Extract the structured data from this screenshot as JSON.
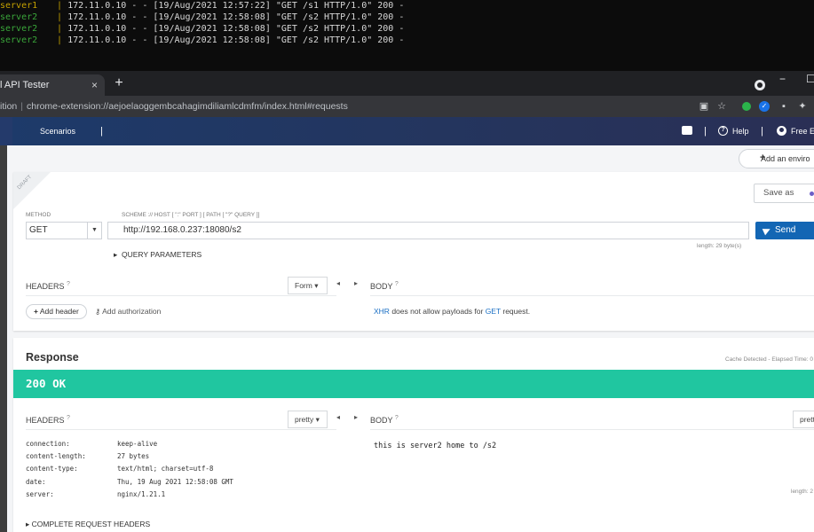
{
  "terminal": {
    "lines": [
      {
        "name": "server1",
        "text": "172.11.0.10 - - [19/Aug/2021 12:57:22] \"GET /s1 HTTP/1.0\" 200 -"
      },
      {
        "name": "server2",
        "text": "172.11.0.10 - - [19/Aug/2021 12:58:08] \"GET /s2 HTTP/1.0\" 200 -"
      },
      {
        "name": "server2",
        "text": "172.11.0.10 - - [19/Aug/2021 12:58:08] \"GET /s2 HTTP/1.0\" 200 -"
      },
      {
        "name": "server2",
        "text": "172.11.0.10 - - [19/Aug/2021 12:58:08] \"GET /s2 HTTP/1.0\" 200 -"
      }
    ],
    "separator": "|"
  },
  "browser": {
    "tab_title": "l API Tester",
    "tab_close": "×",
    "new_tab": "+",
    "min": "−",
    "max": "☐",
    "address_prefix": "ition",
    "address_sep": "|",
    "address": "chrome-extension://aejoelaoggembcahagimdiliamlcdmfm/index.html#requests"
  },
  "nav": {
    "scenarios": "Scenarios",
    "pipe": "|",
    "help": "Help",
    "free": "Free Ed"
  },
  "env": {
    "add_env": "Add an enviro"
  },
  "request": {
    "draft": "DRAFT",
    "save_as": "Save as",
    "method_label": "METHOD",
    "scheme_label": "SCHEME :// HOST [ \":\" PORT ] [ PATH [ \"?\" QUERY ]]",
    "method": "GET",
    "url": "http://192.168.0.237:18080/s2",
    "send": "Send",
    "length": "length: 29 byte(s)",
    "query_params": "QUERY PARAMETERS",
    "headers_label": "HEADERS",
    "help_mark": "?",
    "form": "Form",
    "body_label": "BODY",
    "add_header": "Add header",
    "add_authorization": "Add authorization",
    "body_note_xhr": "XHR",
    "body_note_mid": " does not allow payloads for ",
    "body_note_get": "GET",
    "body_note_end": " request."
  },
  "response": {
    "title": "Response",
    "cache": "Cache Detected - Elapsed Time: 0",
    "status": "200 OK",
    "headers_label": "HEADERS",
    "pretty": "pretty",
    "pretty_body": "prett",
    "body_label": "BODY",
    "headers": [
      {
        "key": "connection:",
        "value": "keep-alive"
      },
      {
        "key": "content-length:",
        "value": "27 bytes"
      },
      {
        "key": "content-type:",
        "value": "text/html; charset=utf-8"
      },
      {
        "key": "date:",
        "value": "Thu, 19 Aug 2021 12:58:08 GMT"
      },
      {
        "key": "server:",
        "value": "nginx/1.21.1"
      }
    ],
    "body": "this is server2 home to /s2",
    "length": "length: 2",
    "complete_headers": "COMPLETE REQUEST HEADERS"
  },
  "colors": {
    "status_bar": "#20c6a0",
    "send_button": "#1366b4",
    "nav_bg": "#24355e"
  }
}
